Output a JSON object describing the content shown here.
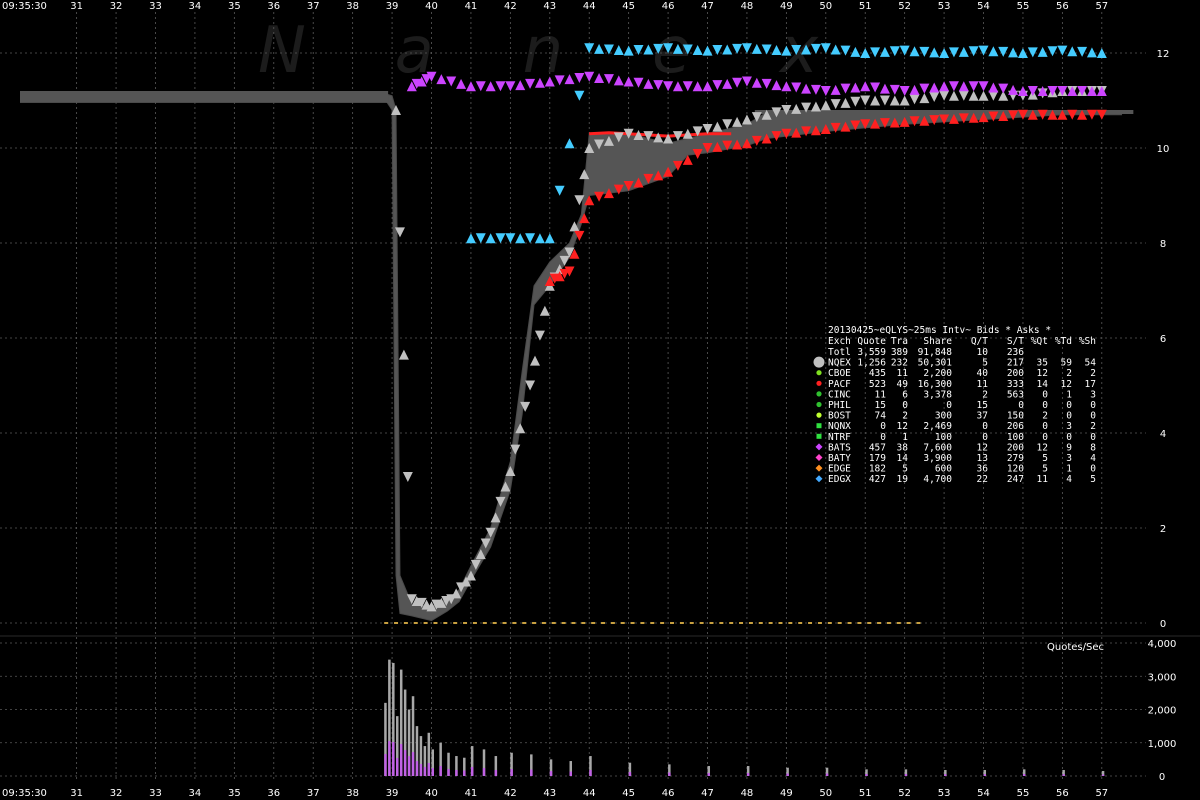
{
  "watermark": "N a n e x",
  "chart_data": [
    {
      "type": "line",
      "chart_name": "price",
      "x_start_label": "09:35:30",
      "x_tick_labels": [
        "31",
        "32",
        "33",
        "34",
        "35",
        "36",
        "37",
        "38",
        "39",
        "40",
        "41",
        "42",
        "43",
        "44",
        "45",
        "46",
        "47",
        "48",
        "49",
        "50",
        "51",
        "52",
        "53",
        "54",
        "55",
        "56",
        "57"
      ],
      "x_range_seconds": [
        30,
        58
      ],
      "y_ticks": [
        "0",
        "2",
        "4",
        "6",
        "8",
        "10",
        "12"
      ],
      "y_range": [
        0,
        12.6
      ],
      "grid": true,
      "nbbo_band": [
        [
          30.0,
          11.15,
          11.05
        ],
        [
          38.8,
          11.15,
          11.05
        ],
        [
          39.0,
          11.1,
          10.8
        ],
        [
          39.1,
          10.8,
          1.0
        ],
        [
          39.2,
          1.0,
          0.2
        ],
        [
          39.5,
          0.4,
          0.15
        ],
        [
          40.0,
          0.35,
          0.05
        ],
        [
          40.4,
          0.5,
          0.25
        ],
        [
          40.7,
          0.7,
          0.45
        ],
        [
          41.0,
          1.2,
          0.9
        ],
        [
          41.5,
          2.0,
          1.6
        ],
        [
          42.0,
          3.4,
          2.8
        ],
        [
          42.3,
          5.3,
          4.4
        ],
        [
          42.6,
          7.1,
          6.7
        ],
        [
          43.0,
          7.6,
          7.1
        ],
        [
          43.5,
          8.0,
          7.7
        ],
        [
          43.8,
          8.6,
          8.4
        ],
        [
          44.0,
          10.3,
          9.0
        ],
        [
          45.0,
          10.3,
          9.1
        ],
        [
          46.0,
          10.1,
          9.4
        ],
        [
          46.5,
          10.2,
          9.85
        ],
        [
          47.0,
          10.3,
          9.9
        ],
        [
          48.0,
          10.5,
          10.05
        ],
        [
          48.5,
          10.75,
          10.2
        ],
        [
          50.0,
          10.75,
          10.35
        ],
        [
          52.0,
          10.75,
          10.5
        ],
        [
          54.0,
          10.75,
          10.6
        ],
        [
          56.0,
          10.75,
          10.7
        ],
        [
          57.5,
          10.75,
          10.7
        ]
      ],
      "red_bid_trace": [
        [
          44.0,
          10.3
        ],
        [
          44.5,
          10.32
        ],
        [
          45.0,
          10.3
        ],
        [
          46.0,
          10.25
        ],
        [
          47.0,
          10.3
        ],
        [
          47.6,
          10.3
        ]
      ],
      "bid_marker_bands": [
        {
          "name": "NQEX",
          "color": "#c0c0c0",
          "x_from": 38.8,
          "x_to": 57.0,
          "y_min": 0.0,
          "y_max": 12.0
        },
        {
          "name": "BATS",
          "color": "#cc44ff",
          "x_from": 38.8,
          "x_to": 57.0,
          "y_min": 0.0,
          "y_max": 11.5
        },
        {
          "name": "EDGX",
          "color": "#44ccff",
          "x_from": 40.5,
          "x_to": 57.0,
          "y_min": 8.0,
          "y_max": 12.1
        }
      ],
      "series": [
        {
          "name": "NQEX",
          "color": "#c0c0c0",
          "x": [
            39.1,
            39.5,
            40.0,
            40.5,
            41.0,
            41.5,
            42.0,
            42.5,
            43.0,
            43.5,
            44.0,
            45.0,
            46.0,
            47.0,
            48.0,
            49.0,
            50.0,
            51.0,
            52.0,
            53.0,
            54.0,
            55.0,
            56.0,
            57.0
          ],
          "y": [
            10.8,
            0.5,
            0.35,
            0.5,
            1.0,
            1.9,
            3.2,
            5.0,
            7.1,
            7.8,
            10.0,
            10.3,
            10.2,
            10.4,
            10.6,
            10.8,
            10.9,
            11.0,
            11.0,
            11.1,
            11.1,
            11.1,
            11.2,
            11.2
          ]
        },
        {
          "name": "PACF",
          "color": "#ff2020",
          "x": [
            43.0,
            43.5,
            44.0,
            45.0,
            46.0,
            47.0,
            48.0,
            49.0,
            50.0,
            51.0,
            52.0,
            53.0,
            54.0,
            55.0,
            56.0,
            57.0
          ],
          "y": [
            7.2,
            7.4,
            8.9,
            9.2,
            9.5,
            10.0,
            10.1,
            10.3,
            10.4,
            10.5,
            10.55,
            10.6,
            10.65,
            10.7,
            10.7,
            10.7
          ]
        },
        {
          "name": "BATS",
          "color": "#cc44ff",
          "x": [
            39.5,
            40.0,
            41.0,
            42.0,
            43.0,
            44.0,
            45.0,
            46.0,
            47.0,
            48.0,
            49.0,
            50.0,
            51.0,
            52.0,
            53.0,
            54.0,
            55.0,
            56.0,
            57.0
          ],
          "y": [
            11.3,
            11.5,
            11.3,
            11.3,
            11.4,
            11.5,
            11.4,
            11.3,
            11.3,
            11.4,
            11.3,
            11.2,
            11.3,
            11.2,
            11.3,
            11.3,
            11.2,
            11.2,
            11.2
          ]
        },
        {
          "name": "EDGX",
          "color": "#44ccff",
          "x": [
            41.0,
            42.0,
            43.0,
            44.0,
            45.0,
            46.0,
            47.0,
            48.0,
            49.0,
            50.0,
            51.0,
            52.0,
            53.0,
            54.0,
            55.0,
            56.0,
            57.0
          ],
          "y": [
            8.1,
            8.1,
            8.1,
            12.1,
            12.05,
            12.1,
            12.05,
            12.1,
            12.05,
            12.1,
            12.0,
            12.05,
            12.0,
            12.05,
            12.0,
            12.05,
            12.0
          ]
        }
      ],
      "legend": {
        "title": "20130425~eQLYS~25ms Intv~ Bids * Asks *",
        "headers": [
          "Exch",
          "Quote",
          "Tra",
          "Share",
          "Q/T",
          "S/T",
          "%Qt",
          "%Td",
          "%Sh"
        ],
        "rows": [
          {
            "exch": "Totl",
            "quote": "3,559",
            "tra": "389",
            "share": "91,848",
            "qt": "10",
            "st": "236",
            "pqt": "",
            "ptd": "",
            "psh": "",
            "color": "",
            "marker": "none"
          },
          {
            "exch": "NQEX",
            "quote": "1,256",
            "tra": "232",
            "share": "50,301",
            "qt": "5",
            "st": "217",
            "pqt": "35",
            "ptd": "59",
            "psh": "54",
            "color": "#c0c0c0",
            "marker": "hexagon"
          },
          {
            "exch": "CBOE",
            "quote": "435",
            "tra": "11",
            "share": "2,200",
            "qt": "40",
            "st": "200",
            "pqt": "12",
            "ptd": "2",
            "psh": "2",
            "color": "#80e020",
            "marker": "dot"
          },
          {
            "exch": "PACF",
            "quote": "523",
            "tra": "49",
            "share": "16,300",
            "qt": "11",
            "st": "333",
            "pqt": "14",
            "ptd": "12",
            "psh": "17",
            "color": "#ff2020",
            "marker": "dot"
          },
          {
            "exch": "CINC",
            "quote": "11",
            "tra": "6",
            "share": "3,378",
            "qt": "2",
            "st": "563",
            "pqt": "0",
            "ptd": "1",
            "psh": "3",
            "color": "#30c030",
            "marker": "dot"
          },
          {
            "exch": "PHIL",
            "quote": "15",
            "tra": "0",
            "share": "0",
            "qt": "15",
            "st": "0",
            "pqt": "0",
            "ptd": "0",
            "psh": "0",
            "color": "#30c030",
            "marker": "dot"
          },
          {
            "exch": "BOST",
            "quote": "74",
            "tra": "2",
            "share": "300",
            "qt": "37",
            "st": "150",
            "pqt": "2",
            "ptd": "0",
            "psh": "0",
            "color": "#c0ff30",
            "marker": "dot"
          },
          {
            "exch": "NQNX",
            "quote": "0",
            "tra": "12",
            "share": "2,469",
            "qt": "0",
            "st": "206",
            "pqt": "0",
            "ptd": "3",
            "psh": "2",
            "color": "#30e040",
            "marker": "square"
          },
          {
            "exch": "NTRF",
            "quote": "0",
            "tra": "1",
            "share": "100",
            "qt": "0",
            "st": "100",
            "pqt": "0",
            "ptd": "0",
            "psh": "0",
            "color": "#30e040",
            "marker": "square"
          },
          {
            "exch": "BATS",
            "quote": "457",
            "tra": "38",
            "share": "7,600",
            "qt": "12",
            "st": "200",
            "pqt": "12",
            "ptd": "9",
            "psh": "8",
            "color": "#cc44ff",
            "marker": "diamond"
          },
          {
            "exch": "BATY",
            "quote": "179",
            "tra": "14",
            "share": "3,900",
            "qt": "13",
            "st": "279",
            "pqt": "5",
            "ptd": "3",
            "psh": "4",
            "color": "#ff44cc",
            "marker": "diamond"
          },
          {
            "exch": "EDGE",
            "quote": "182",
            "tra": "5",
            "share": "600",
            "qt": "36",
            "st": "120",
            "pqt": "5",
            "ptd": "1",
            "psh": "0",
            "color": "#ff9020",
            "marker": "diamond"
          },
          {
            "exch": "EDGX",
            "quote": "427",
            "tra": "19",
            "share": "4,700",
            "qt": "22",
            "st": "247",
            "pqt": "11",
            "ptd": "4",
            "psh": "5",
            "color": "#44aaff",
            "marker": "diamond"
          }
        ]
      }
    },
    {
      "type": "bar",
      "chart_name": "quote_rate",
      "ylabel": "Quotes/Sec",
      "y_ticks": [
        "0",
        "1,000",
        "2,000",
        "3,000",
        "4,000"
      ],
      "y_range": [
        0,
        4000
      ],
      "x": [
        38.8,
        38.9,
        39.0,
        39.1,
        39.2,
        39.3,
        39.4,
        39.5,
        39.6,
        39.7,
        39.8,
        39.9,
        40.0,
        40.2,
        40.4,
        40.6,
        40.8,
        41.0,
        41.3,
        41.6,
        42.0,
        42.5,
        43.0,
        43.5,
        44.0,
        45.0,
        46.0,
        47.0,
        48.0,
        49.0,
        50.0,
        51.0,
        52.0,
        53.0,
        54.0,
        55.0,
        56.0,
        57.0
      ],
      "values": [
        2200,
        3500,
        3400,
        1800,
        3200,
        2600,
        2000,
        2400,
        1500,
        1200,
        900,
        1300,
        800,
        1000,
        700,
        600,
        550,
        900,
        800,
        600,
        700,
        650,
        500,
        450,
        600,
        400,
        350,
        300,
        300,
        250,
        250,
        200,
        200,
        180,
        180,
        200,
        180,
        150
      ]
    }
  ]
}
